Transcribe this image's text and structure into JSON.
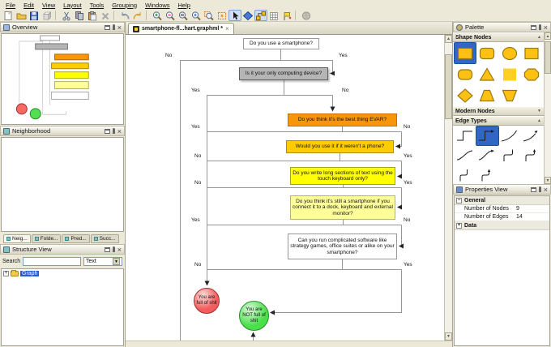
{
  "glyphs": {
    "close": "×",
    "dropdown": "▼",
    "up": "▲",
    "down": "▼",
    "expanded": "−",
    "collapsed": "+",
    "scroll_up": "▲",
    "scroll_down": "▼"
  },
  "menu": {
    "items": [
      "File",
      "Edit",
      "View",
      "Layout",
      "Tools",
      "Grouping",
      "Windows",
      "Help"
    ]
  },
  "toolbar": {
    "icons": [
      {
        "name": "new"
      },
      {
        "name": "open"
      },
      {
        "name": "save"
      },
      {
        "name": "export"
      },
      {
        "separator": true
      },
      {
        "name": "cut"
      },
      {
        "name": "copy"
      },
      {
        "name": "paste"
      },
      {
        "name": "delete"
      },
      {
        "separator": true
      },
      {
        "name": "undo"
      },
      {
        "name": "redo"
      },
      {
        "separator": true
      },
      {
        "name": "zoom-in"
      },
      {
        "name": "zoom-out"
      },
      {
        "name": "zoom-original"
      },
      {
        "name": "fit-content"
      },
      {
        "name": "zoom-selection"
      },
      {
        "name": "fit-selection"
      },
      {
        "name": "edit-mode",
        "pressed": true
      },
      {
        "name": "navigation-mode"
      },
      {
        "name": "orthogonal-mode",
        "pressed": true
      },
      {
        "name": "grid"
      },
      {
        "name": "snap-lines"
      },
      {
        "separator": true
      },
      {
        "name": "overview-globe"
      }
    ]
  },
  "tab": {
    "title": "smartphone-fl...hart.graphml *"
  },
  "panels": {
    "overview": {
      "title": "Overview"
    },
    "neighborhood": {
      "title": "Neighborhood",
      "tabs": [
        "Neig...",
        "Folde...",
        "Pred...",
        "Succ..."
      ]
    },
    "structure": {
      "title": "Structure View",
      "search_label": "Search",
      "search_value": "",
      "filter_value": "Text",
      "root_label": "Graph"
    },
    "palette": {
      "title": "Palette",
      "sections": [
        {
          "label": "Shape Nodes"
        },
        {
          "label": "Modern Nodes"
        },
        {
          "label": "Edge Types"
        }
      ],
      "shape_items": [
        "rectangle",
        "rounded-rectangle",
        "ellipse",
        "rectangle-plain",
        "round-rectangle",
        "triangle",
        "gradient-rectangle",
        "octagon",
        "diamond",
        "trapezoid",
        "trapezoid-inverted"
      ],
      "shape_selected_index": 0,
      "edge_items": [
        "polyline",
        "polyline-arrow",
        "arc",
        "arc-arrow",
        "curve",
        "curve-arrow",
        "step",
        "step-arrow",
        "step2",
        "step2-arrow"
      ],
      "edge_selected_index": 1
    },
    "properties": {
      "title": "Properties View",
      "groups": [
        {
          "label": "General",
          "rows": [
            {
              "name": "Number of Nodes",
              "value": "9"
            },
            {
              "name": "Number of Edges",
              "value": "14"
            }
          ]
        },
        {
          "label": "Data",
          "rows": []
        }
      ]
    }
  },
  "flowchart": {
    "nodes": [
      {
        "label": "Do you use a smartphone?",
        "fill": "#ffffff",
        "border": "#999999"
      },
      {
        "label": "Is it your only computing device?",
        "fill": "#b5b5b5",
        "border": "#5f5f5f"
      },
      {
        "label": "Do you think it's the best thing EVAR?",
        "fill": "#f7950b",
        "border": "#c17300"
      },
      {
        "label": "Would you use it if it weren't a phone?",
        "fill": "#ffcc00",
        "border": "#b18e10"
      },
      {
        "label": "Do you write long sections of text using the touch keyboard only?",
        "fill": "#ffff00",
        "border": "#a3a316"
      },
      {
        "label": "Do you think it's still a smartphone if you connect it to a dock, keyboard and external monitor?",
        "fill": "#ffff99",
        "border": "#b4b46a"
      },
      {
        "label": "Can you run complicated software like strategy games, office suites or alike on your smartphone?",
        "fill": "#ffffff",
        "border": "#999999"
      },
      {
        "label": "You are full of shit",
        "fill": "#f25c5c",
        "border": "#a03030"
      },
      {
        "label": "You are NOT full of shit",
        "fill": "#4ae04a",
        "border": "#2a8a2a"
      }
    ],
    "edge_labels": [
      {
        "text": "No"
      },
      {
        "text": "Yes"
      },
      {
        "text": "Yes"
      },
      {
        "text": "No"
      },
      {
        "text": "Yes"
      },
      {
        "text": "No"
      },
      {
        "text": "No"
      },
      {
        "text": "Yes"
      },
      {
        "text": "No"
      },
      {
        "text": "Yes"
      },
      {
        "text": "Yes"
      },
      {
        "text": "No"
      },
      {
        "text": "No"
      },
      {
        "text": "Yes"
      }
    ]
  }
}
